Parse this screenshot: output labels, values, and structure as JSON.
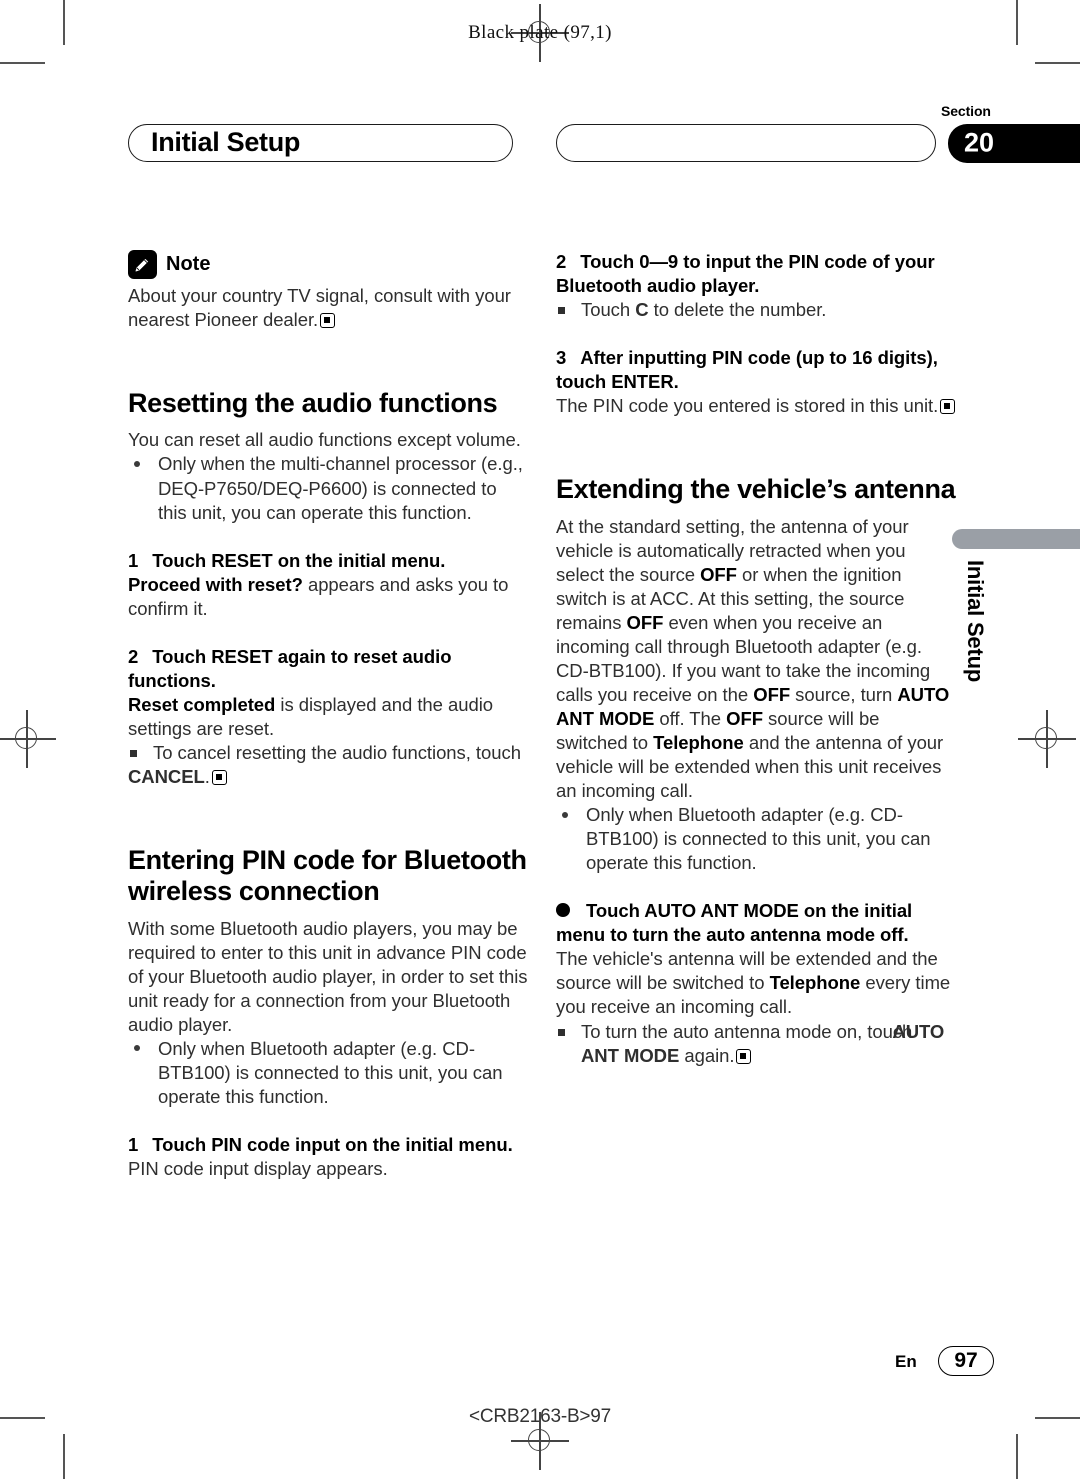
{
  "page": {
    "plate_label": "Black plate (97,1)",
    "footer_lang": "En",
    "footer_page": "97",
    "footer_code": "<CRB2163-B>97"
  },
  "header": {
    "chapter_title": "Initial Setup",
    "section_label": "Section",
    "section_number": "20",
    "side_tab_text": "Initial Setup",
    "side_tab_color": "#9a9fa6"
  },
  "left_column": {
    "note": {
      "icon": "pencil-icon",
      "title": "Note",
      "text": "About your country TV signal, consult with your nearest Pioneer dealer."
    },
    "reset_section": {
      "heading": "Resetting the audio functions",
      "intro": "You can reset all audio functions except volume.",
      "bullet": "Only when the multi-channel processor (e.g., DEQ-P7650/DEQ-P6600) is connected to this unit, you can operate this function.",
      "step1_num": "1",
      "step1_text": "Touch RESET on the initial menu.",
      "step1_body_bold": "Proceed with reset?",
      "step1_body_rest": " appears and asks you to confirm it.",
      "step2_num": "2",
      "step2_text": "Touch RESET again to reset audio functions.",
      "step2_body_bold": "Reset completed",
      "step2_body_rest": " is displayed and the audio settings are reset.",
      "step2_note_pre": "To cancel resetting the audio functions, touch ",
      "step2_note_bold": "CANCEL",
      "step2_note_post": "."
    },
    "pin_section": {
      "heading": "Entering PIN code for Bluetooth wireless connection",
      "intro": "With some Bluetooth audio players, you may be required to enter to this unit in advance PIN code of your Bluetooth audio player, in order to set this unit ready for a connection from your Bluetooth audio player.",
      "bullet": "Only when Bluetooth adapter (e.g. CD-BTB100) is connected to this unit, you can operate this function.",
      "step1_num": "1",
      "step1_text": "Touch PIN code input on the initial menu.",
      "step1_body": "PIN code input display appears."
    }
  },
  "right_column": {
    "pin_steps": {
      "step2_num": "2",
      "step2_text": "Touch 0—9 to input the PIN code of your Bluetooth audio player.",
      "step2_note_pre": "Touch ",
      "step2_note_bold": "C",
      "step2_note_post": " to delete the number.",
      "step3_num": "3",
      "step3_text": "After inputting PIN code (up to 16 digits), touch ENTER.",
      "step3_body": "The PIN code you entered is stored in this unit."
    },
    "antenna_section": {
      "heading": "Extending the vehicle’s antenna",
      "para_1": "At the standard setting, the antenna of your vehicle is automatically retracted when you select the source ",
      "para_b1": "OFF",
      "para_2": " or when the ignition switch is at ACC. At this setting, the source remains ",
      "para_b2": "OFF",
      "para_3": " even when you receive an incoming call through Bluetooth adapter (e.g. CD-BTB100). If you want to take the incoming calls you receive on the ",
      "para_b3": "OFF",
      "para_4": " source, turn ",
      "para_b4": "AUTO ANT MODE",
      "para_5": " off. The ",
      "para_b5": "OFF",
      "para_6": " source will be switched to ",
      "para_b6": "Telephone",
      "para_7": " and the antenna of your vehicle will be extended when this unit receives an incoming call.",
      "bullet": "Only when Bluetooth adapter (e.g. CD-BTB100) is connected to this unit, you can operate this function.",
      "instruction": "Touch AUTO ANT MODE on the initial menu to turn the auto antenna mode off.",
      "instr_body_1": "The vehicle's antenna will be extended and the source will be switched to ",
      "instr_body_b": "Telephone",
      "instr_body_2": " every time you receive an incoming call.",
      "note_pre": "To turn the auto antenna mode on, touch ",
      "note_bold": "AUTO ANT MODE",
      "note_post": " again."
    }
  }
}
